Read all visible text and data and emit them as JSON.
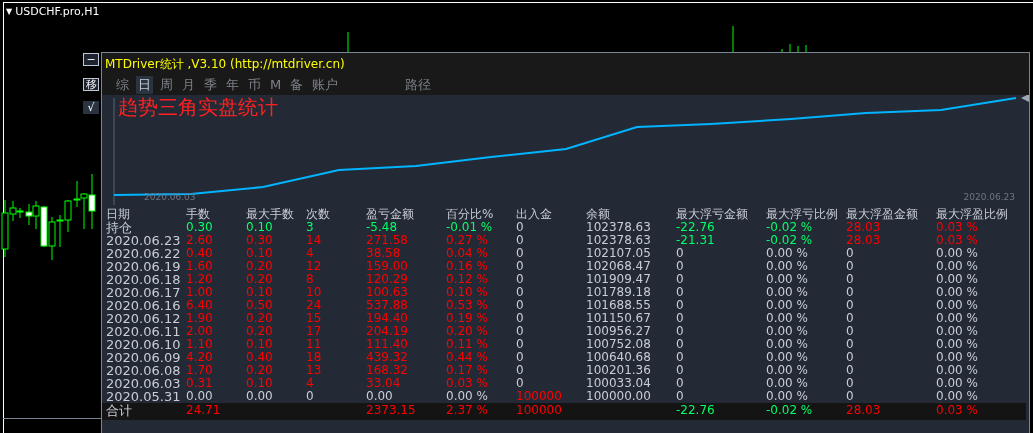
{
  "chart": {
    "collapse_glyph": "▼",
    "symbol": "USDCHF.pro,H1"
  },
  "side_buttons": [
    {
      "label": "−",
      "kind": "outlined"
    },
    {
      "label": "移",
      "kind": "outlined"
    },
    {
      "label": "√",
      "kind": "filled"
    }
  ],
  "panel": {
    "title": "MTDriver统计 ,V3.10 (http://mtdriver.cn)",
    "tabs": [
      {
        "label": "综",
        "selected": false
      },
      {
        "label": "日",
        "selected": true
      },
      {
        "label": "周",
        "selected": false
      },
      {
        "label": "月",
        "selected": false
      },
      {
        "label": "季",
        "selected": false
      },
      {
        "label": "年",
        "selected": false
      },
      {
        "label": "币",
        "selected": false
      },
      {
        "label": "M",
        "selected": false
      },
      {
        "label": "备",
        "selected": false
      },
      {
        "label": "账户",
        "selected": false
      }
    ],
    "path_label": "路径",
    "equity": {
      "title": "趋势三角实盘统计",
      "start_date": "2020.06.03",
      "end_date": "2020.06.23"
    },
    "table": {
      "columns": [
        "日期",
        "手数",
        "最大手数",
        "次数",
        "盈亏金额",
        "百分比%",
        "出入金",
        "余额",
        "最大浮亏金额",
        "最大浮亏比例",
        "最大浮盈金额",
        "最大浮盈比例"
      ],
      "rows": [
        {
          "cells": [
            {
              "text": "持仓",
              "color": "#c8cdd6"
            },
            {
              "text": "0.30",
              "color": "#00ff66"
            },
            {
              "text": "0.10",
              "color": "#00ff66"
            },
            {
              "text": "3",
              "color": "#00ff66"
            },
            {
              "text": "-5.48",
              "color": "#00ff66"
            },
            {
              "text": "-0.01 %",
              "color": "#00ff66"
            },
            {
              "text": "0",
              "color": "#c8cdd6"
            },
            {
              "text": "102378.63",
              "color": "#c8cdd6"
            },
            {
              "text": "-22.76",
              "color": "#00ff66"
            },
            {
              "text": "-0.02 %",
              "color": "#00ff66"
            },
            {
              "text": "28.03",
              "color": "#ff0000"
            },
            {
              "text": "0.03 %",
              "color": "#ff0000"
            }
          ]
        },
        {
          "cells": [
            {
              "text": "2020.06.23",
              "color": "#c8cdd6"
            },
            {
              "text": "2.60",
              "color": "#ff0000"
            },
            {
              "text": "0.30",
              "color": "#ff0000"
            },
            {
              "text": "14",
              "color": "#ff0000"
            },
            {
              "text": "271.58",
              "color": "#ff0000"
            },
            {
              "text": "0.27 %",
              "color": "#ff0000"
            },
            {
              "text": "0",
              "color": "#c8cdd6"
            },
            {
              "text": "102378.63",
              "color": "#c8cdd6"
            },
            {
              "text": "-21.31",
              "color": "#00ff66"
            },
            {
              "text": "-0.02 %",
              "color": "#00ff66"
            },
            {
              "text": "28.03",
              "color": "#ff0000"
            },
            {
              "text": "0.03 %",
              "color": "#ff0000"
            }
          ]
        },
        {
          "cells": [
            {
              "text": "2020.06.22",
              "color": "#c8cdd6"
            },
            {
              "text": "0.40",
              "color": "#ff0000"
            },
            {
              "text": "0.10",
              "color": "#ff0000"
            },
            {
              "text": "4",
              "color": "#ff0000"
            },
            {
              "text": "38.58",
              "color": "#ff0000"
            },
            {
              "text": "0.04 %",
              "color": "#ff0000"
            },
            {
              "text": "0",
              "color": "#c8cdd6"
            },
            {
              "text": "102107.05",
              "color": "#c8cdd6"
            },
            {
              "text": "0",
              "color": "#c8cdd6"
            },
            {
              "text": "0.00 %",
              "color": "#c8cdd6"
            },
            {
              "text": "0",
              "color": "#c8cdd6"
            },
            {
              "text": "0.00 %",
              "color": "#c8cdd6"
            }
          ]
        },
        {
          "cells": [
            {
              "text": "2020.06.19",
              "color": "#c8cdd6"
            },
            {
              "text": "1.60",
              "color": "#ff0000"
            },
            {
              "text": "0.20",
              "color": "#ff0000"
            },
            {
              "text": "12",
              "color": "#ff0000"
            },
            {
              "text": "159.00",
              "color": "#ff0000"
            },
            {
              "text": "0.16 %",
              "color": "#ff0000"
            },
            {
              "text": "0",
              "color": "#c8cdd6"
            },
            {
              "text": "102068.47",
              "color": "#c8cdd6"
            },
            {
              "text": "0",
              "color": "#c8cdd6"
            },
            {
              "text": "0.00 %",
              "color": "#c8cdd6"
            },
            {
              "text": "0",
              "color": "#c8cdd6"
            },
            {
              "text": "0.00 %",
              "color": "#c8cdd6"
            }
          ]
        },
        {
          "cells": [
            {
              "text": "2020.06.18",
              "color": "#c8cdd6"
            },
            {
              "text": "1.20",
              "color": "#ff0000"
            },
            {
              "text": "0.20",
              "color": "#ff0000"
            },
            {
              "text": "8",
              "color": "#ff0000"
            },
            {
              "text": "120.29",
              "color": "#ff0000"
            },
            {
              "text": "0.12 %",
              "color": "#ff0000"
            },
            {
              "text": "0",
              "color": "#c8cdd6"
            },
            {
              "text": "101909.47",
              "color": "#c8cdd6"
            },
            {
              "text": "0",
              "color": "#c8cdd6"
            },
            {
              "text": "0.00 %",
              "color": "#c8cdd6"
            },
            {
              "text": "0",
              "color": "#c8cdd6"
            },
            {
              "text": "0.00 %",
              "color": "#c8cdd6"
            }
          ]
        },
        {
          "cells": [
            {
              "text": "2020.06.17",
              "color": "#c8cdd6"
            },
            {
              "text": "1.00",
              "color": "#ff0000"
            },
            {
              "text": "0.10",
              "color": "#ff0000"
            },
            {
              "text": "10",
              "color": "#ff0000"
            },
            {
              "text": "100.63",
              "color": "#ff0000"
            },
            {
              "text": "0.10 %",
              "color": "#ff0000"
            },
            {
              "text": "0",
              "color": "#c8cdd6"
            },
            {
              "text": "101789.18",
              "color": "#c8cdd6"
            },
            {
              "text": "0",
              "color": "#c8cdd6"
            },
            {
              "text": "0.00 %",
              "color": "#c8cdd6"
            },
            {
              "text": "0",
              "color": "#c8cdd6"
            },
            {
              "text": "0.00 %",
              "color": "#c8cdd6"
            }
          ]
        },
        {
          "cells": [
            {
              "text": "2020.06.16",
              "color": "#c8cdd6"
            },
            {
              "text": "6.40",
              "color": "#ff0000"
            },
            {
              "text": "0.50",
              "color": "#ff0000"
            },
            {
              "text": "24",
              "color": "#ff0000"
            },
            {
              "text": "537.88",
              "color": "#ff0000"
            },
            {
              "text": "0.53 %",
              "color": "#ff0000"
            },
            {
              "text": "0",
              "color": "#c8cdd6"
            },
            {
              "text": "101688.55",
              "color": "#c8cdd6"
            },
            {
              "text": "0",
              "color": "#c8cdd6"
            },
            {
              "text": "0.00 %",
              "color": "#c8cdd6"
            },
            {
              "text": "0",
              "color": "#c8cdd6"
            },
            {
              "text": "0.00 %",
              "color": "#c8cdd6"
            }
          ]
        },
        {
          "cells": [
            {
              "text": "2020.06.12",
              "color": "#c8cdd6"
            },
            {
              "text": "1.90",
              "color": "#ff0000"
            },
            {
              "text": "0.20",
              "color": "#ff0000"
            },
            {
              "text": "15",
              "color": "#ff0000"
            },
            {
              "text": "194.40",
              "color": "#ff0000"
            },
            {
              "text": "0.19 %",
              "color": "#ff0000"
            },
            {
              "text": "0",
              "color": "#c8cdd6"
            },
            {
              "text": "101150.67",
              "color": "#c8cdd6"
            },
            {
              "text": "0",
              "color": "#c8cdd6"
            },
            {
              "text": "0.00 %",
              "color": "#c8cdd6"
            },
            {
              "text": "0",
              "color": "#c8cdd6"
            },
            {
              "text": "0.00 %",
              "color": "#c8cdd6"
            }
          ]
        },
        {
          "cells": [
            {
              "text": "2020.06.11",
              "color": "#c8cdd6"
            },
            {
              "text": "2.00",
              "color": "#ff0000"
            },
            {
              "text": "0.20",
              "color": "#ff0000"
            },
            {
              "text": "17",
              "color": "#ff0000"
            },
            {
              "text": "204.19",
              "color": "#ff0000"
            },
            {
              "text": "0.20 %",
              "color": "#ff0000"
            },
            {
              "text": "0",
              "color": "#c8cdd6"
            },
            {
              "text": "100956.27",
              "color": "#c8cdd6"
            },
            {
              "text": "0",
              "color": "#c8cdd6"
            },
            {
              "text": "0.00 %",
              "color": "#c8cdd6"
            },
            {
              "text": "0",
              "color": "#c8cdd6"
            },
            {
              "text": "0.00 %",
              "color": "#c8cdd6"
            }
          ]
        },
        {
          "cells": [
            {
              "text": "2020.06.10",
              "color": "#c8cdd6"
            },
            {
              "text": "1.10",
              "color": "#ff0000"
            },
            {
              "text": "0.10",
              "color": "#ff0000"
            },
            {
              "text": "11",
              "color": "#ff0000"
            },
            {
              "text": "111.40",
              "color": "#ff0000"
            },
            {
              "text": "0.11 %",
              "color": "#ff0000"
            },
            {
              "text": "0",
              "color": "#c8cdd6"
            },
            {
              "text": "100752.08",
              "color": "#c8cdd6"
            },
            {
              "text": "0",
              "color": "#c8cdd6"
            },
            {
              "text": "0.00 %",
              "color": "#c8cdd6"
            },
            {
              "text": "0",
              "color": "#c8cdd6"
            },
            {
              "text": "0.00 %",
              "color": "#c8cdd6"
            }
          ]
        },
        {
          "cells": [
            {
              "text": "2020.06.09",
              "color": "#c8cdd6"
            },
            {
              "text": "4.20",
              "color": "#ff0000"
            },
            {
              "text": "0.40",
              "color": "#ff0000"
            },
            {
              "text": "18",
              "color": "#ff0000"
            },
            {
              "text": "439.32",
              "color": "#ff0000"
            },
            {
              "text": "0.44 %",
              "color": "#ff0000"
            },
            {
              "text": "0",
              "color": "#c8cdd6"
            },
            {
              "text": "100640.68",
              "color": "#c8cdd6"
            },
            {
              "text": "0",
              "color": "#c8cdd6"
            },
            {
              "text": "0.00 %",
              "color": "#c8cdd6"
            },
            {
              "text": "0",
              "color": "#c8cdd6"
            },
            {
              "text": "0.00 %",
              "color": "#c8cdd6"
            }
          ]
        },
        {
          "cells": [
            {
              "text": "2020.06.08",
              "color": "#c8cdd6"
            },
            {
              "text": "1.70",
              "color": "#ff0000"
            },
            {
              "text": "0.20",
              "color": "#ff0000"
            },
            {
              "text": "13",
              "color": "#ff0000"
            },
            {
              "text": "168.32",
              "color": "#ff0000"
            },
            {
              "text": "0.17 %",
              "color": "#ff0000"
            },
            {
              "text": "0",
              "color": "#c8cdd6"
            },
            {
              "text": "100201.36",
              "color": "#c8cdd6"
            },
            {
              "text": "0",
              "color": "#c8cdd6"
            },
            {
              "text": "0.00 %",
              "color": "#c8cdd6"
            },
            {
              "text": "0",
              "color": "#c8cdd6"
            },
            {
              "text": "0.00 %",
              "color": "#c8cdd6"
            }
          ]
        },
        {
          "cells": [
            {
              "text": "2020.06.03",
              "color": "#c8cdd6"
            },
            {
              "text": "0.31",
              "color": "#ff0000"
            },
            {
              "text": "0.10",
              "color": "#ff0000"
            },
            {
              "text": "4",
              "color": "#ff0000"
            },
            {
              "text": "33.04",
              "color": "#ff0000"
            },
            {
              "text": "0.03 %",
              "color": "#ff0000"
            },
            {
              "text": "0",
              "color": "#c8cdd6"
            },
            {
              "text": "100033.04",
              "color": "#c8cdd6"
            },
            {
              "text": "0",
              "color": "#c8cdd6"
            },
            {
              "text": "0.00 %",
              "color": "#c8cdd6"
            },
            {
              "text": "0",
              "color": "#c8cdd6"
            },
            {
              "text": "0.00 %",
              "color": "#c8cdd6"
            }
          ]
        },
        {
          "cells": [
            {
              "text": "2020.05.31",
              "color": "#c8cdd6"
            },
            {
              "text": "0.00",
              "color": "#c8cdd6"
            },
            {
              "text": "0.00",
              "color": "#c8cdd6"
            },
            {
              "text": "0",
              "color": "#c8cdd6"
            },
            {
              "text": "0.00",
              "color": "#c8cdd6"
            },
            {
              "text": "0.00 %",
              "color": "#c8cdd6"
            },
            {
              "text": "100000",
              "color": "#ff0000"
            },
            {
              "text": "100000.00",
              "color": "#c8cdd6"
            },
            {
              "text": "0",
              "color": "#c8cdd6"
            },
            {
              "text": "0.00 %",
              "color": "#c8cdd6"
            },
            {
              "text": "0",
              "color": "#c8cdd6"
            },
            {
              "text": "0.00 %",
              "color": "#c8cdd6"
            }
          ]
        }
      ],
      "total": {
        "cells": [
          {
            "text": "合计",
            "color": "#c8cdd6"
          },
          {
            "text": "24.71",
            "color": "#ff0000"
          },
          null,
          null,
          {
            "text": "2373.15",
            "color": "#ff0000"
          },
          {
            "text": "2.37 %",
            "color": "#ff0000"
          },
          {
            "text": "100000",
            "color": "#ff0000"
          },
          null,
          {
            "text": "-22.76",
            "color": "#00ff66"
          },
          {
            "text": "-0.02 %",
            "color": "#00ff66"
          },
          {
            "text": "28.03",
            "color": "#ff0000"
          },
          {
            "text": "0.03 %",
            "color": "#ff0000"
          }
        ]
      }
    }
  }
}
